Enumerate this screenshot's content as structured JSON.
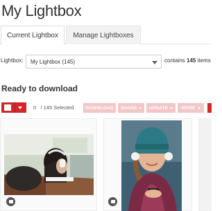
{
  "page": {
    "title": "My Lightbox"
  },
  "tabs": [
    {
      "label": "Current Lightbox",
      "active": true
    },
    {
      "label": "Manage Lightboxes",
      "active": false
    }
  ],
  "lightbox": {
    "label": "Lightbox:",
    "selected": "My Lightbox (145)",
    "contains_prefix": "contains ",
    "count": "145",
    "contains_suffix": " items"
  },
  "section": {
    "title": "Ready to download"
  },
  "toolbar": {
    "selected_count": "0",
    "total_text": "/ 145 Selected",
    "download_label": "DOWNLOAD",
    "share_label": "SHARE",
    "update_label": "UPDATE",
    "more_label": "MORE"
  },
  "items": [
    {
      "subject": "student with headphones at desk",
      "note_icon": "note-icon"
    },
    {
      "subject": "smiling woman with headphones and phone",
      "note_icon": "note-icon"
    },
    {
      "subject": "partial image",
      "note_icon": ""
    }
  ],
  "colors": {
    "accent": "#d4252a",
    "disabled_accent": "#f3c6c7",
    "text": "#333333",
    "border": "#dddddd"
  }
}
